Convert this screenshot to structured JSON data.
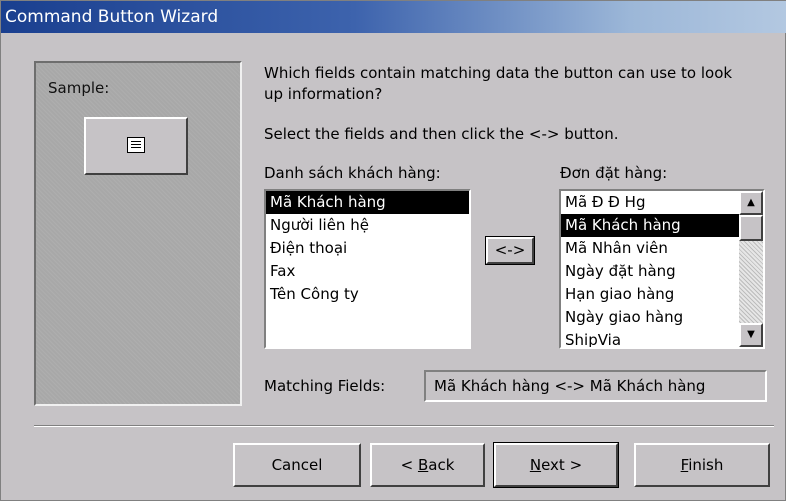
{
  "window": {
    "title": "Command Button Wizard"
  },
  "sample": {
    "label": "Sample:",
    "icon": "form-icon"
  },
  "instructions": {
    "line1": "Which fields contain matching data the button can use to look",
    "line2": "up information?",
    "line3": "Select the fields and then click the <-> button."
  },
  "left_list": {
    "header": "Danh sách khách hàng:",
    "items": [
      "Mã Khách hàng",
      "Người liên hệ",
      "Điện thoại",
      "Fax",
      "Tên Công ty"
    ],
    "selected_index": 0
  },
  "right_list": {
    "header": "Đơn đặt hàng:",
    "items": [
      "Mã Đ Đ Hg",
      "Mã Khách hàng",
      "Mã Nhân viên",
      "Ngày đặt hàng",
      "Hạn giao hàng",
      "Ngày giao hàng",
      "ShipVia"
    ],
    "selected_index": 1
  },
  "match_button": {
    "label": "<->"
  },
  "matching": {
    "label": "Matching Fields:",
    "value": "Mã Khách hàng <-> Mã Khách hàng"
  },
  "buttons": {
    "cancel": "Cancel",
    "back_prefix": "< ",
    "back_key": "B",
    "back_rest": "ack",
    "next_key": "N",
    "next_rest": "ext >",
    "finish_key": "F",
    "finish_rest": "inish"
  }
}
